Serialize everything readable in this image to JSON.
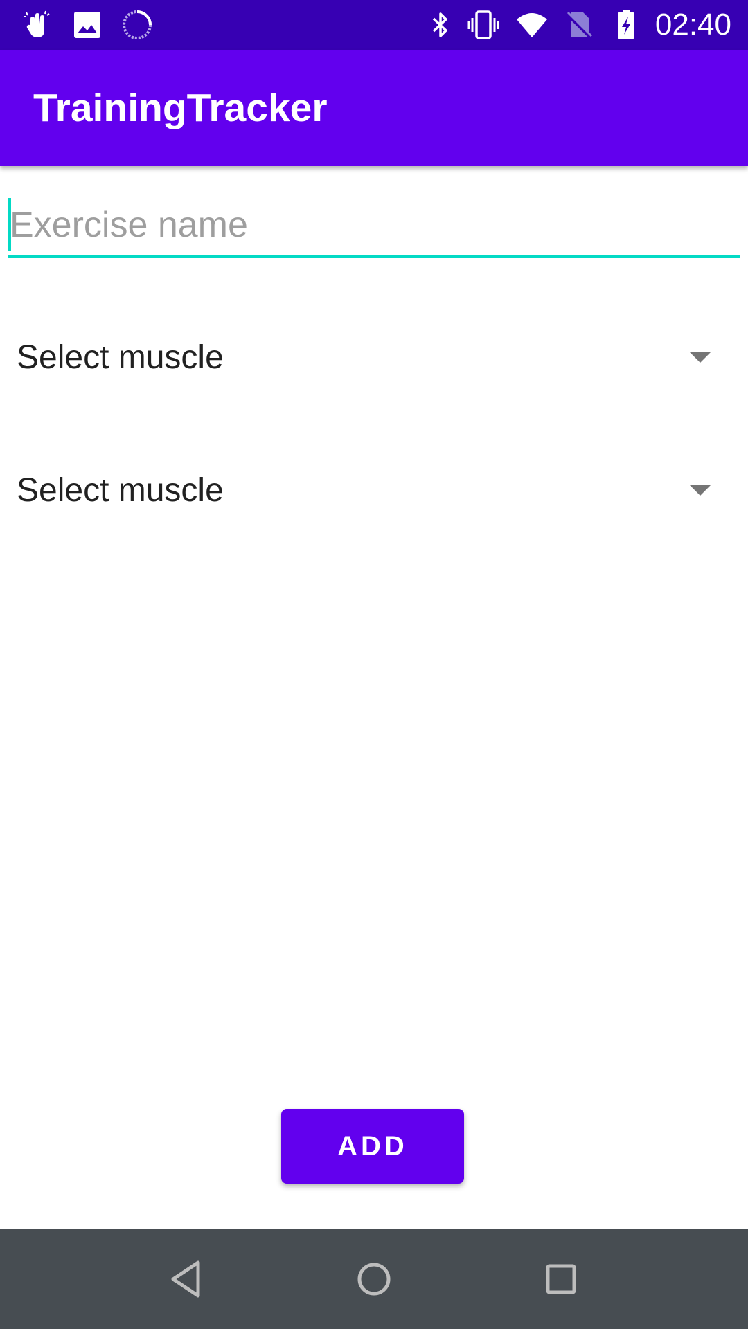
{
  "status_bar": {
    "time": "02:40",
    "left_icons": [
      "touch-gesture-icon",
      "image-icon",
      "sync-icon"
    ],
    "right_icons": [
      "bluetooth-icon",
      "vibrate-icon",
      "wifi-icon",
      "no-sim-icon",
      "battery-charging-icon"
    ]
  },
  "app_bar": {
    "title": "TrainingTracker"
  },
  "form": {
    "exercise_name": {
      "value": "",
      "placeholder": "Exercise name"
    },
    "muscle_spinners": [
      {
        "selected": "Select muscle"
      },
      {
        "selected": "Select muscle"
      }
    ],
    "add_label": "ADD"
  },
  "nav_bar": {
    "buttons": [
      "back-icon",
      "home-icon",
      "recents-icon"
    ]
  },
  "colors": {
    "status_bar": "#3700b3",
    "primary": "#6200ee",
    "accent": "#03dac5",
    "nav_bar": "#474d52"
  }
}
